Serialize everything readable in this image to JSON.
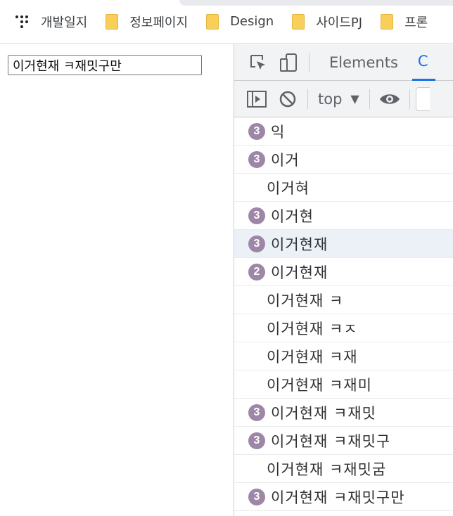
{
  "bookmarks": [
    {
      "label": "개발일지",
      "icon": "apps-icon"
    },
    {
      "label": "정보페이지",
      "icon": "folder-icon"
    },
    {
      "label": "Design",
      "icon": "folder-icon"
    },
    {
      "label": "사이드PJ",
      "icon": "folder-icon"
    },
    {
      "label": "프론",
      "icon": "folder-icon"
    }
  ],
  "page": {
    "input_value": "이거현재 ㅋ재밋구만"
  },
  "devtools": {
    "tabs": [
      "Elements",
      "C"
    ],
    "active_tab_index": 1,
    "context": "top",
    "console_rows": [
      {
        "count": "3",
        "text": "익",
        "highlight": false
      },
      {
        "count": "3",
        "text": "이거",
        "highlight": false
      },
      {
        "count": "",
        "text": "이거혀",
        "highlight": false
      },
      {
        "count": "3",
        "text": "이거현",
        "highlight": false
      },
      {
        "count": "3",
        "text": "이거현재",
        "highlight": true
      },
      {
        "count": "2",
        "text": "이거현재",
        "highlight": false
      },
      {
        "count": "",
        "text": "이거현재 ㅋ",
        "highlight": false
      },
      {
        "count": "",
        "text": "이거현재 ㅋㅈ",
        "highlight": false
      },
      {
        "count": "",
        "text": "이거현재 ㅋ재",
        "highlight": false
      },
      {
        "count": "",
        "text": "이거현재 ㅋ재미",
        "highlight": false
      },
      {
        "count": "3",
        "text": "이거현재 ㅋ재밋",
        "highlight": false
      },
      {
        "count": "3",
        "text": "이거현재 ㅋ재밋구",
        "highlight": false
      },
      {
        "count": "",
        "text": "이거현재 ㅋ재밋굼",
        "highlight": false
      },
      {
        "count": "3",
        "text": "이거현재 ㅋ재밋구만",
        "highlight": false
      }
    ]
  },
  "colors": {
    "badge": "#9e86a6",
    "highlight_row": "#ecf1f8",
    "active_tab": "#1a73e8"
  }
}
